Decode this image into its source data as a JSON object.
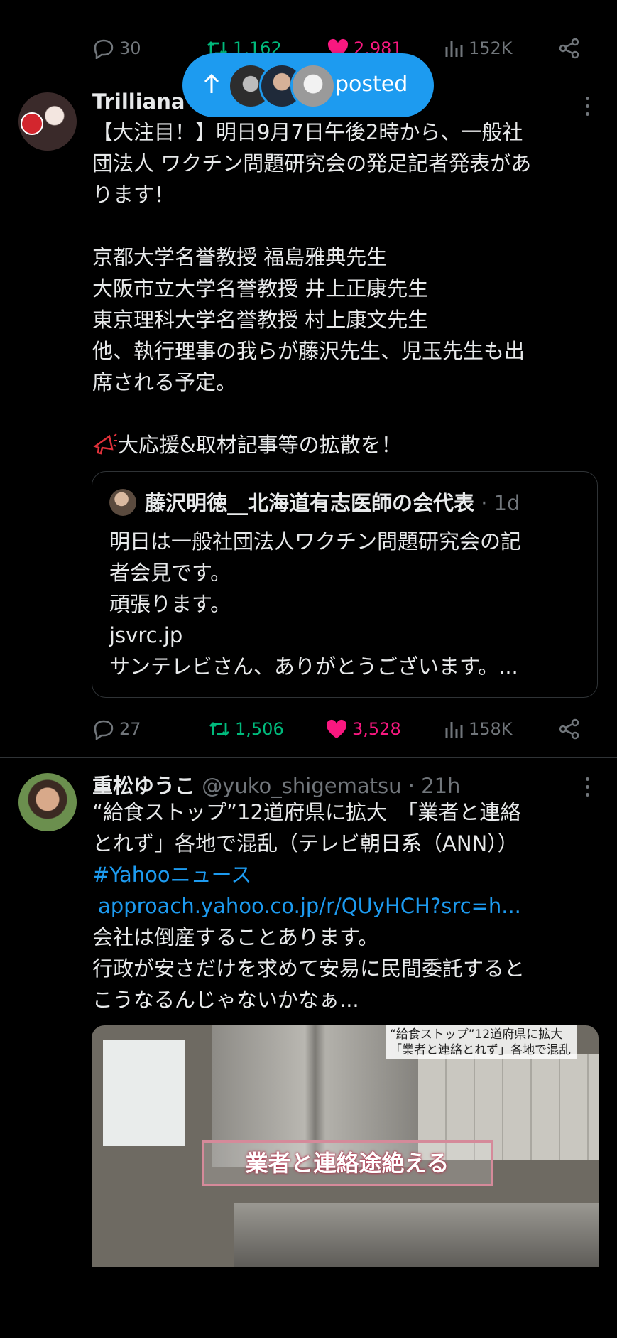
{
  "top_actions": {
    "replies": "30",
    "reposts": "1,162",
    "likes": "2,981",
    "views": "152K"
  },
  "new_posts_pill": {
    "label": "posted"
  },
  "tweet1": {
    "name": "Trilliana",
    "lines": [
      "【大注目！】明日9月7日午後2時から、一般社",
      "団法人 ワクチン問題研究会の発足記者発表があ",
      "ります！",
      "",
      "京都大学名誉教授 福島雅典先生",
      "大阪市立大学名誉教授 井上正康先生",
      "東京理科大学名誉教授 村上康文先生",
      "他、執行理事の我らが藤沢先生、児玉先生も出",
      "席される予定。",
      "",
      "大応援&取材記事等の拡散を！"
    ],
    "quote": {
      "name": "藤沢明徳__北海道有志医師の会代表",
      "meta": "· 1d",
      "lines": [
        "明日は一般社団法人ワクチン問題研究会の記",
        "者会見です。",
        "頑張ります。",
        "jsvrc.jp",
        "サンテレビさん、ありがとうございます。..."
      ]
    },
    "actions": {
      "replies": "27",
      "reposts": "1,506",
      "likes": "3,528",
      "views": "158K"
    }
  },
  "tweet2": {
    "name": "重松ゆうこ",
    "handle": "@yuko_shigematsu",
    "time": "· 21h",
    "line1": "“給食ストップ”12道府県に拡大　「業者と連絡",
    "line2": "とれず」各地で混乱（テレビ朝日系（ANN））",
    "hashtag": "#Yahooニュース",
    "url": "approach.yahoo.co.jp/r/QUyHCH?src=h...",
    "line5": "会社は倒産することあります。",
    "line6": "行政が安さだけを求めて安易に民間委託すると",
    "line7": "こうなるんじゃないかなぁ...",
    "media": {
      "overlay_line1": "“給食ストップ”12道府県に拡大",
      "overlay_line2": "「業者と連絡とれず」各地で混乱",
      "caption": "業者と連絡途絶える"
    }
  },
  "colors": {
    "accent": "#1d9bf0",
    "like": "#f91880",
    "repost": "#00ba7c",
    "muted": "#71767b"
  },
  "icons": [
    "reply-icon",
    "repost-icon",
    "like-icon",
    "views-icon",
    "share-icon",
    "more-icon",
    "arrow-up-icon",
    "megaphone-icon"
  ]
}
